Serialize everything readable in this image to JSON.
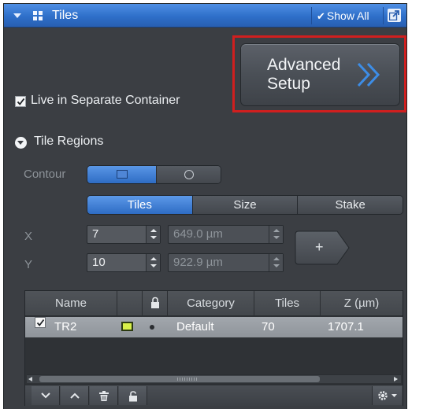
{
  "panel": {
    "title": "Tiles",
    "show_all_label": "Show All",
    "show_all_checked": true
  },
  "advanced_setup": {
    "label": "Advanced Setup"
  },
  "live_container": {
    "label": "Live in Separate Container",
    "checked": true
  },
  "tile_regions": {
    "section_label": "Tile Regions",
    "contour_label": "Contour",
    "contour_options": [
      "rectangle-icon",
      "circle-icon"
    ],
    "contour_selected": "rectangle-icon",
    "tabs": [
      "Tiles",
      "Size",
      "Stake"
    ],
    "active_tab": "Tiles",
    "x_label": "X",
    "y_label": "Y",
    "x_tiles": "7",
    "y_tiles": "10",
    "x_size": "649.0 µm",
    "y_size": "922.9 µm",
    "add_button_label": "+"
  },
  "table": {
    "columns": [
      "Name",
      "",
      "lock-icon",
      "Category",
      "Tiles",
      "Z (µm)"
    ],
    "rows": [
      {
        "checked": true,
        "name": "TR2",
        "color": "#d8f04a",
        "category": "Default",
        "tiles": "70",
        "z": "1707.1"
      }
    ]
  },
  "colors": {
    "title_bar": "#2e6fc9",
    "panel_bg": "#3b3e43",
    "highlight_box": "#d01f1f",
    "selected_row": "#9aa0a6",
    "advanced_chevron": "#3d8de6"
  },
  "footer_icons": [
    "chevron-down-icon",
    "chevron-up-icon",
    "trash-icon",
    "unlock-icon",
    "gear-icon"
  ]
}
